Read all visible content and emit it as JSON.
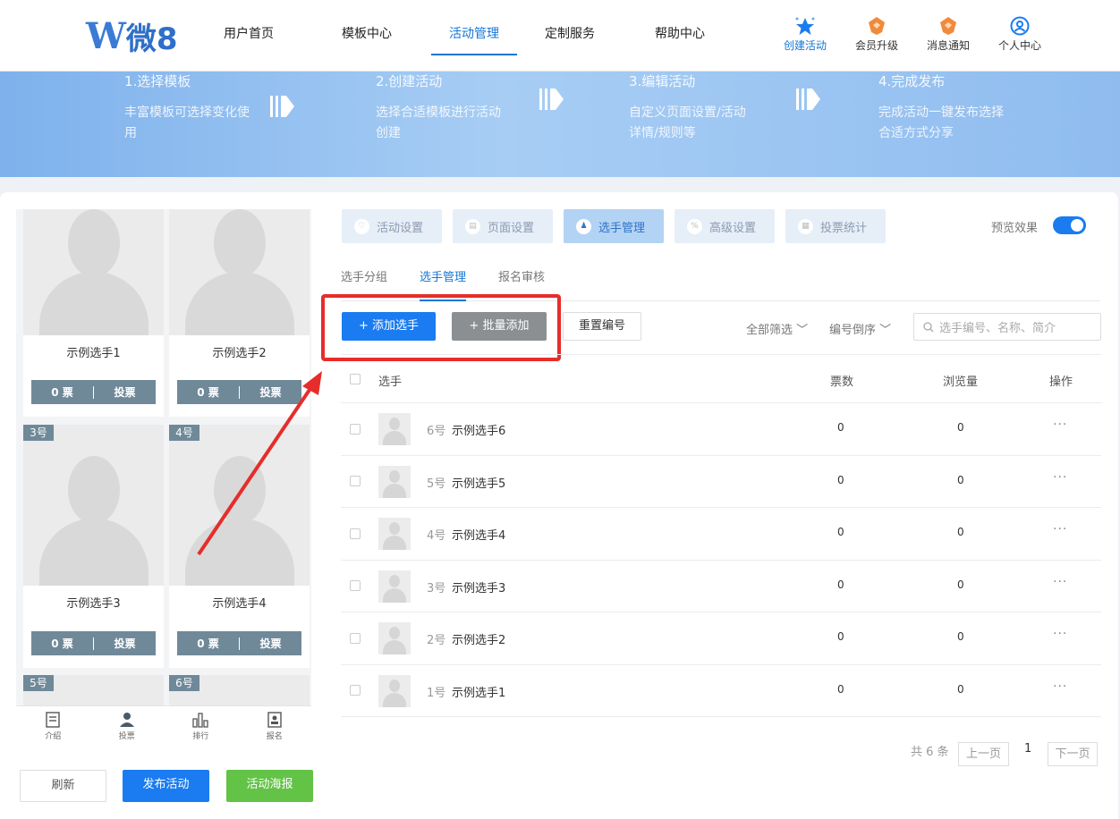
{
  "header": {
    "logo_text": "微8",
    "nav": [
      {
        "label": "用户首页",
        "active": false
      },
      {
        "label": "模板中心",
        "active": false
      },
      {
        "label": "活动管理",
        "active": true
      },
      {
        "label": "定制服务",
        "active": false
      },
      {
        "label": "帮助中心",
        "active": false
      }
    ],
    "icons": [
      {
        "label": "创建活动",
        "icon": "star-icon"
      },
      {
        "label": "会员升级",
        "icon": "crown-icon"
      },
      {
        "label": "消息通知",
        "icon": "bell-icon"
      },
      {
        "label": "个人中心",
        "icon": "user-icon"
      }
    ]
  },
  "banner": {
    "steps": [
      {
        "title": "1.选择模板",
        "desc": "丰富模板可选择变化使用"
      },
      {
        "title": "2.创建活动",
        "desc": "选择合适模板进行活动创建"
      },
      {
        "title": "3.编辑活动",
        "desc": "自定义页面设置/活动详情/规则等"
      },
      {
        "title": "4.完成发布",
        "desc": "完成活动一键发布选择合适方式分享"
      }
    ]
  },
  "preview": {
    "candidates": [
      {
        "name": "示例选手1",
        "votes": "0 票",
        "vote_btn": "投票",
        "tag": ""
      },
      {
        "name": "示例选手2",
        "votes": "0 票",
        "vote_btn": "投票",
        "tag": ""
      },
      {
        "name": "示例选手3",
        "votes": "0 票",
        "vote_btn": "投票",
        "tag": "3号"
      },
      {
        "name": "示例选手4",
        "votes": "0 票",
        "vote_btn": "投票",
        "tag": "4号"
      }
    ],
    "tags_bottom": [
      "5号",
      "6号"
    ],
    "tabbar": [
      {
        "label": "介绍",
        "icon": "document-icon"
      },
      {
        "label": "投票",
        "icon": "person-icon"
      },
      {
        "label": "排行",
        "icon": "bar-chart-icon"
      },
      {
        "label": "报名",
        "icon": "badge-icon"
      }
    ],
    "buttons": {
      "refresh": "刷新",
      "publish": "发布活动",
      "poster": "活动海报"
    }
  },
  "toptabs": [
    {
      "label": "活动设置",
      "active": false
    },
    {
      "label": "页面设置",
      "active": false
    },
    {
      "label": "选手管理",
      "active": true
    },
    {
      "label": "高级设置",
      "active": false
    },
    {
      "label": "投票统计",
      "active": false
    }
  ],
  "preview_toggle": {
    "label": "预览效果",
    "on": true
  },
  "subtabs": [
    {
      "label": "选手分组",
      "active": false
    },
    {
      "label": "选手管理",
      "active": true
    },
    {
      "label": "报名审核",
      "active": false
    }
  ],
  "actions": {
    "add": "+ 添加选手",
    "batch_add": "+ 批量添加",
    "renumber": "重置编号",
    "filter_all": "全部筛选",
    "sort": "编号倒序",
    "search_placeholder": "选手编号、名称、简介"
  },
  "table": {
    "columns": [
      "选手",
      "票数",
      "浏览量",
      "操作"
    ],
    "rows": [
      {
        "num": "6号",
        "name": "示例选手6",
        "votes": "0",
        "views": "0",
        "op": "···"
      },
      {
        "num": "5号",
        "name": "示例选手5",
        "votes": "0",
        "views": "0",
        "op": "···"
      },
      {
        "num": "4号",
        "name": "示例选手4",
        "votes": "0",
        "views": "0",
        "op": "···"
      },
      {
        "num": "3号",
        "name": "示例选手3",
        "votes": "0",
        "views": "0",
        "op": "···"
      },
      {
        "num": "2号",
        "name": "示例选手2",
        "votes": "0",
        "views": "0",
        "op": "···"
      },
      {
        "num": "1号",
        "name": "示例选手1",
        "votes": "0",
        "views": "0",
        "op": "···"
      }
    ]
  },
  "pagination": {
    "total": "共 6 条",
    "prev": "上一页",
    "current": "1",
    "next": "下一页"
  },
  "colors": {
    "primary": "#1a7cf0",
    "accent_nav": "#1476d6",
    "highlight": "#e62d2a",
    "green": "#63c346",
    "bar": "#6f8999"
  }
}
